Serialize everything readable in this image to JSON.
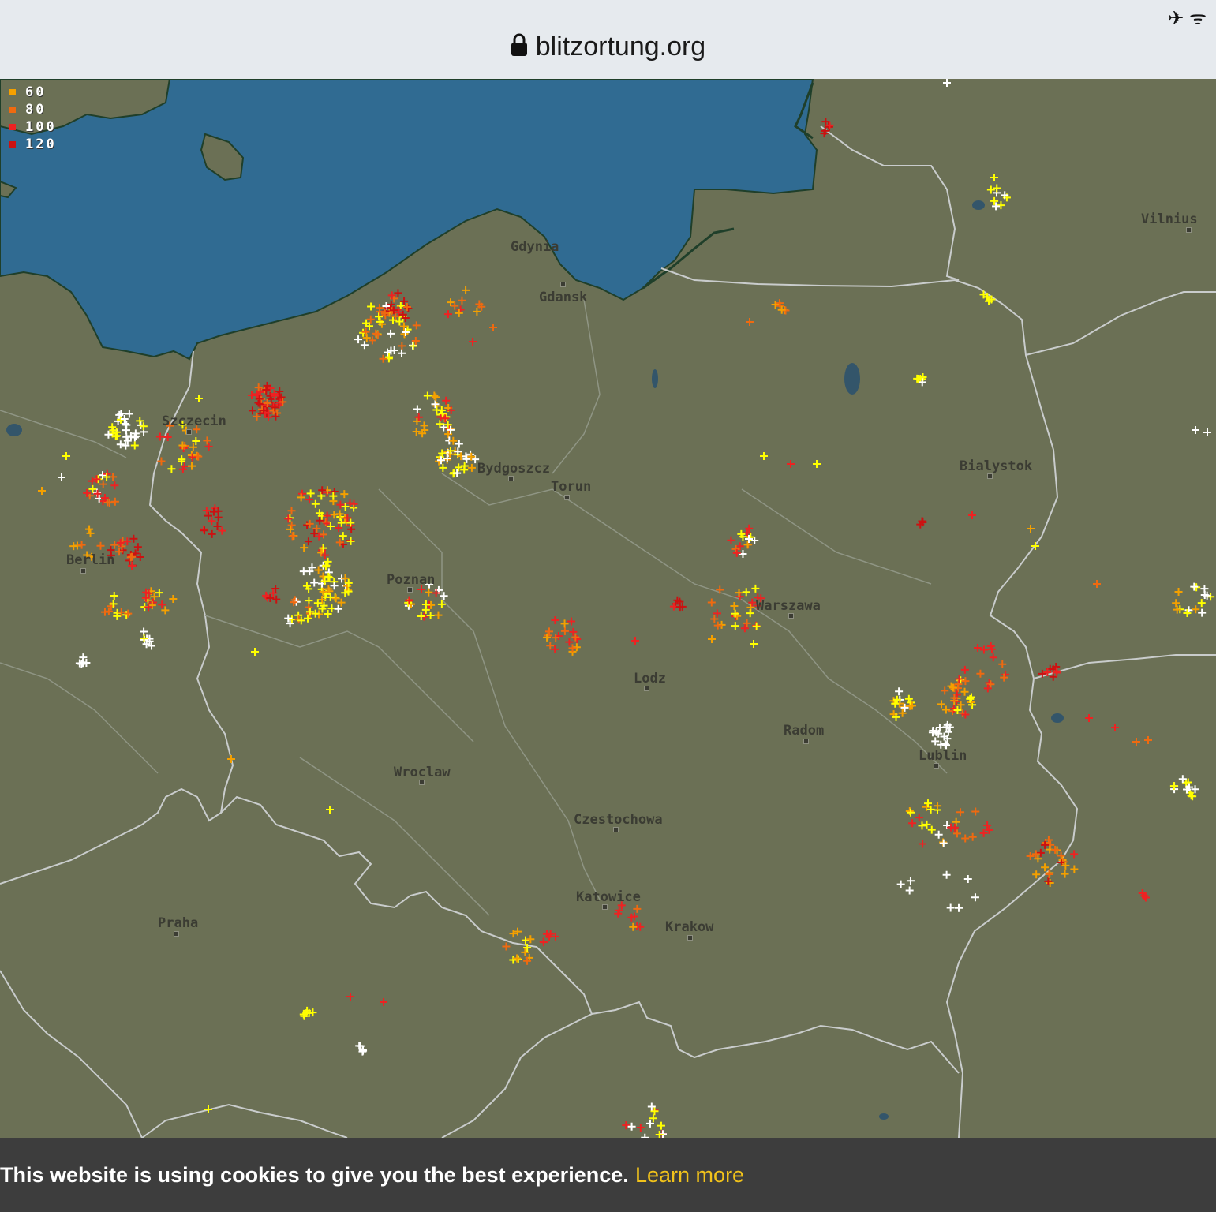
{
  "browser": {
    "url": "blitzortung.org",
    "status_icons": "✈ ᯤ"
  },
  "legend": [
    {
      "label": "60",
      "color": "#f4a000"
    },
    {
      "label": "80",
      "color": "#ef6a10"
    },
    {
      "label": "100",
      "color": "#ee2222"
    },
    {
      "label": "120",
      "color": "#cc1111"
    }
  ],
  "cities": {
    "gdynia": "Gdynia",
    "gdansk": "Gdansk",
    "vilnius": "Vilnius",
    "szczecin": "Szczecin",
    "bydgoszcz": "Bydgoszcz",
    "torun": "Torun",
    "bialystok": "Bialystok",
    "berlin": "Berlin",
    "poznan": "Poznan",
    "warszawa": "Warszawa",
    "lodz": "Lodz",
    "radom": "Radom",
    "lublin": "Lublin",
    "wroclaw": "Wroclaw",
    "czestochowa": "Czestochowa",
    "katowice": "Katowice",
    "krakow": "Krakow",
    "praha": "Praha"
  },
  "strike_colors": {
    "white": "#ffffff",
    "yellow": "#ffff00",
    "orange_light": "#f4a000",
    "orange": "#ef6a10",
    "red": "#ee2222",
    "dark_red": "#cc1111"
  },
  "map_colors": {
    "sea": "#306b92",
    "land": "#6b7055",
    "border": "#c9cccc",
    "lake": "#33556a"
  },
  "cookie": {
    "message": "This website is using cookies to give you the best experience.",
    "link": "Learn more"
  }
}
